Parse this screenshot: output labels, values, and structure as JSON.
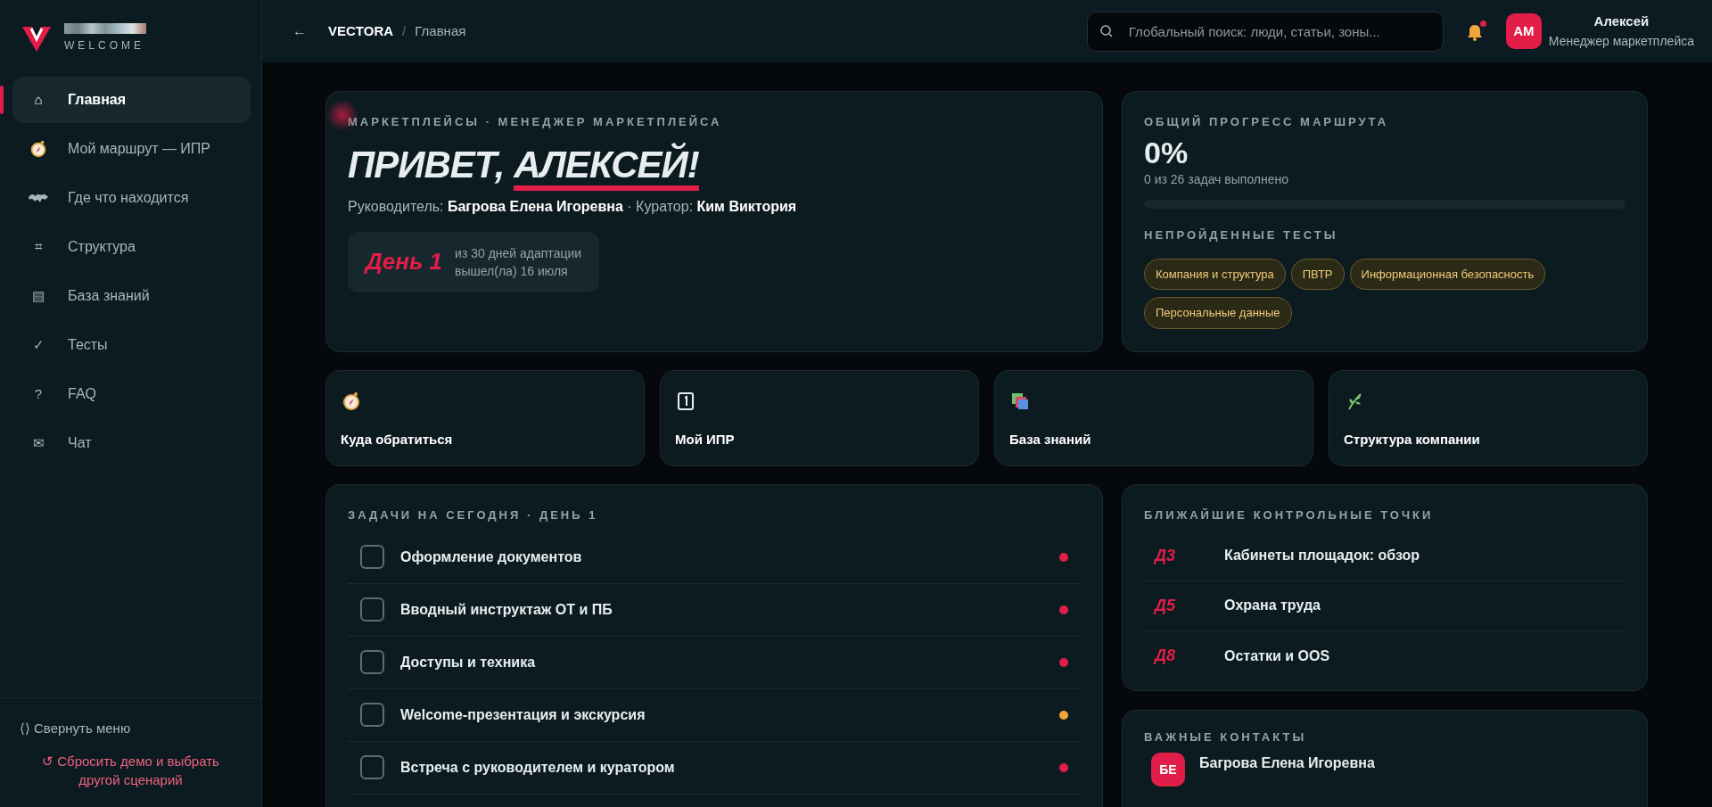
{
  "sidebar": {
    "logo_caption": "WELCOME",
    "items": [
      {
        "icon": "⌂",
        "label": "Главная",
        "selected": true
      },
      {
        "kind": "compass",
        "label": "Мой маршрут — ИПР",
        "selected": false
      },
      {
        "kind": "map",
        "label": "Где что находится",
        "selected": false
      },
      {
        "icon": "⌗",
        "label": "Структура",
        "selected": false
      },
      {
        "icon": "▤",
        "label": "База знаний",
        "selected": false
      },
      {
        "icon": "✓",
        "label": "Тесты",
        "selected": false
      },
      {
        "icon": "?",
        "label": "FAQ",
        "selected": false
      },
      {
        "icon": "✉",
        "label": "Чат",
        "selected": false
      }
    ],
    "collapse_icon": "⟨⟩",
    "collapse": "Свернуть меню",
    "reset": "↺ Сбросить демо и выбрать другой сценарий"
  },
  "header": {
    "back": "←",
    "breadcrumb": [
      "VECTORA",
      "Главная"
    ],
    "breadcrumb_separator": "/",
    "search": {
      "placeholder": "Глобальный поиск: люди, статьи, зоны..."
    },
    "notifications": {
      "unread": true
    },
    "user": {
      "initials": "АМ",
      "name": "Алексей",
      "role": "Менеджер маркетплейса"
    }
  },
  "hero": {
    "eyebrow": "МАРКЕТПЛЕЙСЫ · МЕНЕДЖЕР МАРКЕТПЛЕЙСА",
    "greeting": "ПРИВЕТ,",
    "name": "АЛЕКСЕЙ!",
    "people": "Руководитель: **Багрова Елена Игоревна** · Куратор: **Ким Виктория**",
    "day": {
      "label": "День 1",
      "of": "из 30 дней адаптации",
      "started": "вышел(ла) 16 июля"
    }
  },
  "progress": {
    "title": "ОБЩИЙ ПРОГРЕСС МАРШРУТА",
    "percent": "0%",
    "caption": "0 из 26 задач выполнено",
    "level": 0,
    "tests_title": "НЕПРОЙДЕННЫЕ ТЕСТЫ",
    "tests": [
      "Компания и структура",
      "ПВТР",
      "Информационная безопасность",
      "Персональные данные"
    ]
  },
  "quick_links": [
    {
      "kind": "compass",
      "label": "Куда обратиться"
    },
    {
      "kind": "calendar",
      "label": "Мой ИПР"
    },
    {
      "kind": "stack",
      "label": "База знаний"
    },
    {
      "kind": "leaf",
      "label": "Структура компании"
    }
  ],
  "tasks": {
    "title": "ЗАДАЧИ НА СЕГОДНЯ · ДЕНЬ 1",
    "items": [
      {
        "label": "Оформление документов",
        "checked": false,
        "color": "#e11d48"
      },
      {
        "label": "Вводный инструктаж ОТ и ПБ",
        "checked": false,
        "color": "#e11d48"
      },
      {
        "label": "Доступы и техника",
        "checked": false,
        "color": "#e11d48"
      },
      {
        "label": "Welcome-презентация и экскурсия",
        "checked": false,
        "color": "#f0a53a"
      },
      {
        "label": "Встреча с руководителем и куратором",
        "checked": false,
        "color": "#e11d48"
      }
    ]
  },
  "checkpoints": {
    "title": "БЛИЖАЙШИЕ КОНТРОЛЬНЫЕ ТОЧКИ",
    "items": [
      {
        "day": "Д3",
        "label": "Кабинеты площадок: обзор"
      },
      {
        "day": "Д5",
        "label": "Охрана труда"
      },
      {
        "day": "Д8",
        "label": "Остатки и OOS"
      }
    ]
  },
  "contacts": {
    "title": "ВАЖНЫЕ КОНТАКТЫ",
    "items": [
      {
        "initials": "БЕ",
        "name": "Багрова Елена Игоревна"
      }
    ]
  }
}
